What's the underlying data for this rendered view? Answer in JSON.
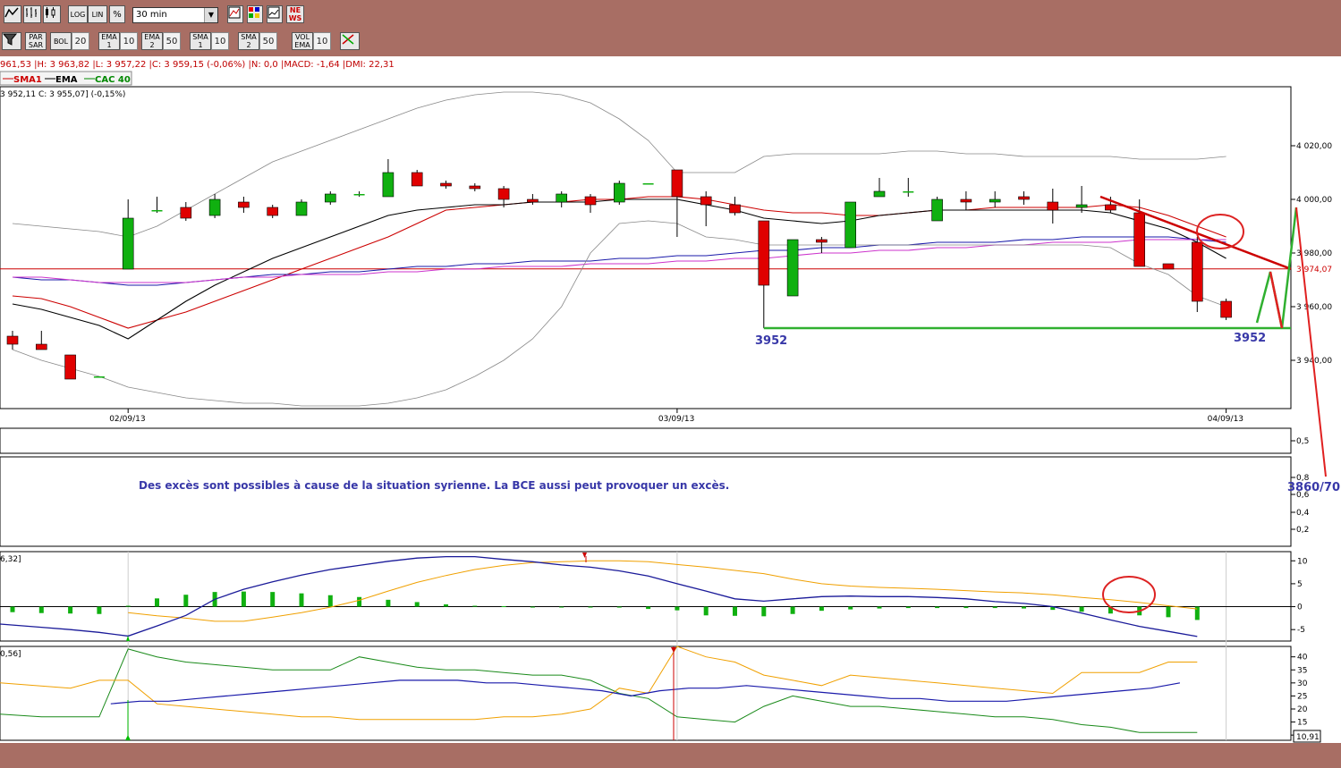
{
  "toolbar": {
    "interval": "30 min",
    "row1": [
      {
        "icon": "line-chart-icon"
      },
      {
        "icon": "bar-chart-icon"
      },
      {
        "icon": "candlestick-icon"
      },
      {
        "label": "LOG"
      },
      {
        "label": "LIN"
      },
      {
        "label": "%"
      }
    ],
    "row1_right": [
      {
        "icon": "compare-icon"
      },
      {
        "icon": "color-grid-icon"
      },
      {
        "icon": "chart-window-icon"
      },
      {
        "label": "NE WS"
      }
    ],
    "row2": [
      {
        "label": "PAR SAR"
      },
      {
        "label": "BOL",
        "value": "20"
      },
      {
        "label": "EMA 1",
        "value": "10"
      },
      {
        "label": "EMA 2",
        "value": "50"
      },
      {
        "label": "SMA 1",
        "value": "10"
      },
      {
        "label": "SMA 2",
        "value": "50"
      },
      {
        "label": "VOL EMA",
        "value": "10"
      }
    ]
  },
  "info": {
    "ohlc_line": "961,53 |H: 3 963,82 |L: 3 957,22 |C: 3 959,15 (-0,06%) |N: 0,0 |MACD: -1,64 |DMI: 22,31",
    "legend": [
      {
        "name": "SMA1",
        "color": "#cc0000"
      },
      {
        "name": "EMA",
        "color": "#000000"
      },
      {
        "name": "CAC 40",
        "color": "#008800"
      }
    ],
    "second_line": "3 952,11  C: 3 955,07] (-0,15%)"
  },
  "annotations": {
    "support_left": "3952",
    "support_right": "3952",
    "target": "3860/70",
    "comment": "Des excès sont possibles à cause de la situation syrienne. La BCE aussi peut provoquer un excès."
  },
  "panel_labels": {
    "macd": "6,32]",
    "dmi": "0,56]",
    "dmi_last": "10,91"
  },
  "colors": {
    "up": "#10b010",
    "down": "#e00000",
    "sma1": "#cc0000",
    "ema": "#000000",
    "long_ma": "#1a1aaa",
    "pink_ma": "#cc33cc",
    "bollinger": "#888888",
    "macd_signal": "#f0a000",
    "macd_line": "#1a1a99",
    "dmi_plus": "#1a8a1a",
    "dmi_minus": "#f0a000",
    "adx": "#1a1aaa",
    "support": "#30b030",
    "resistance": "#cc0000",
    "projection_up": "#30b030",
    "projection_down": "#e02020",
    "circle": "#dd2222"
  },
  "chart_data": [
    {
      "type": "candlestick",
      "title": "CAC 40",
      "interval": "30 min",
      "x_ticks": [
        "02/09/13",
        "03/09/13",
        "04/09/13"
      ],
      "y_ticks": [
        4020,
        4000,
        3980,
        3960,
        3940
      ],
      "y_tick_labels": [
        "4 020,00",
        "4 000,00",
        "3 980,00",
        "3 960,00",
        "3 940,00"
      ],
      "ylim": [
        3922,
        4042
      ],
      "last_price": 3974.07,
      "last_price_label": "3 974,07",
      "support_level": 3952,
      "candles": [
        {
          "o": 3949,
          "h": 3951,
          "l": 3944,
          "c": 3946
        },
        {
          "o": 3946,
          "h": 3951,
          "l": 3944,
          "c": 3944
        },
        {
          "o": 3942,
          "h": 3942,
          "l": 3933,
          "c": 3933
        },
        {
          "o": 3934,
          "h": 3934,
          "l": 3934,
          "c": 3934
        },
        {
          "o": 3974,
          "h": 4000,
          "l": 3974,
          "c": 3993
        },
        {
          "o": 3996,
          "h": 4001,
          "l": 3995,
          "c": 3996
        },
        {
          "o": 3997,
          "h": 3999,
          "l": 3992,
          "c": 3993
        },
        {
          "o": 3994,
          "h": 4002,
          "l": 3993,
          "c": 4000
        },
        {
          "o": 3999,
          "h": 4001,
          "l": 3995,
          "c": 3997
        },
        {
          "o": 3997,
          "h": 3998,
          "l": 3993,
          "c": 3994
        },
        {
          "o": 3994,
          "h": 4000,
          "l": 3994,
          "c": 3999
        },
        {
          "o": 3999,
          "h": 4003,
          "l": 3998,
          "c": 4002
        },
        {
          "o": 4002,
          "h": 4003,
          "l": 4001,
          "c": 4002
        },
        {
          "o": 4001,
          "h": 4015,
          "l": 4001,
          "c": 4010
        },
        {
          "o": 4010,
          "h": 4011,
          "l": 4005,
          "c": 4005
        },
        {
          "o": 4006,
          "h": 4007,
          "l": 4004,
          "c": 4005
        },
        {
          "o": 4005,
          "h": 4006,
          "l": 4003,
          "c": 4004
        },
        {
          "o": 4004,
          "h": 4005,
          "l": 3997,
          "c": 4000
        },
        {
          "o": 4000,
          "h": 4002,
          "l": 3998,
          "c": 3999
        },
        {
          "o": 3999,
          "h": 4003,
          "l": 3997,
          "c": 4002
        },
        {
          "o": 4001,
          "h": 4002,
          "l": 3995,
          "c": 3998
        },
        {
          "o": 3999,
          "h": 4007,
          "l": 3998,
          "c": 4006
        },
        {
          "o": 4006,
          "h": 4006,
          "l": 4006,
          "c": 4006
        },
        {
          "o": 4011,
          "h": 4011,
          "l": 3986,
          "c": 4001
        },
        {
          "o": 4001,
          "h": 4003,
          "l": 3990,
          "c": 3998
        },
        {
          "o": 3998,
          "h": 4001,
          "l": 3994,
          "c": 3995
        },
        {
          "o": 3992,
          "h": 3992,
          "l": 3952,
          "c": 3968
        },
        {
          "o": 3964,
          "h": 3985,
          "l": 3964,
          "c": 3985
        },
        {
          "o": 3985,
          "h": 3986,
          "l": 3980,
          "c": 3984
        },
        {
          "o": 3982,
          "h": 3999,
          "l": 3982,
          "c": 3999
        },
        {
          "o": 4001,
          "h": 4008,
          "l": 4001,
          "c": 4003
        },
        {
          "o": 4003,
          "h": 4008,
          "l": 4001,
          "c": 4003
        },
        {
          "o": 3992,
          "h": 4001,
          "l": 3992,
          "c": 4000
        },
        {
          "o": 4000,
          "h": 4003,
          "l": 3996,
          "c": 3999
        },
        {
          "o": 3999,
          "h": 4003,
          "l": 3997,
          "c": 4000
        },
        {
          "o": 4001,
          "h": 4003,
          "l": 3998,
          "c": 4000
        },
        {
          "o": 3999,
          "h": 4004,
          "l": 3991,
          "c": 3996
        },
        {
          "o": 3997,
          "h": 4005,
          "l": 3995,
          "c": 3998
        },
        {
          "o": 3998,
          "h": 4001,
          "l": 3995,
          "c": 3996
        },
        {
          "o": 3995,
          "h": 4000,
          "l": 3975,
          "c": 3975
        },
        {
          "o": 3976,
          "h": 3976,
          "l": 3974,
          "c": 3974
        },
        {
          "o": 3984,
          "h": 3986,
          "l": 3958,
          "c": 3962
        },
        {
          "o": 3962,
          "h": 3963,
          "l": 3955,
          "c": 3956
        }
      ],
      "ma_series": [
        {
          "key": "sma1",
          "values": [
            3964,
            3963,
            3960,
            3956,
            3952,
            3955,
            3958,
            3962,
            3966,
            3970,
            3974,
            3978,
            3982,
            3986,
            3991,
            3996,
            3997,
            3998,
            3999,
            3999,
            4000,
            4000,
            4001,
            4001,
            4000,
            3998,
            3996,
            3995,
            3995,
            3994,
            3994,
            3995,
            3996,
            3996,
            3997,
            3997,
            3997,
            3997,
            3998,
            3997,
            3994,
            3990,
            3986
          ]
        },
        {
          "key": "ema",
          "values": [
            3961,
            3959,
            3956,
            3953,
            3948,
            3955,
            3962,
            3968,
            3973,
            3978,
            3982,
            3986,
            3990,
            3994,
            3996,
            3997,
            3998,
            3998,
            3999,
            3999,
            3999,
            4000,
            4000,
            4000,
            3998,
            3996,
            3993,
            3992,
            3991,
            3992,
            3994,
            3995,
            3996,
            3996,
            3996,
            3996,
            3996,
            3996,
            3995,
            3992,
            3989,
            3984,
            3978
          ]
        },
        {
          "key": "long_ma",
          "values": [
            3971,
            3970,
            3970,
            3969,
            3968,
            3968,
            3969,
            3970,
            3971,
            3972,
            3972,
            3973,
            3973,
            3974,
            3975,
            3975,
            3976,
            3976,
            3977,
            3977,
            3977,
            3978,
            3978,
            3979,
            3979,
            3980,
            3981,
            3981,
            3982,
            3982,
            3983,
            3983,
            3984,
            3984,
            3984,
            3985,
            3985,
            3986,
            3986,
            3986,
            3986,
            3985,
            3984
          ]
        },
        {
          "key": "pink_ma",
          "values": [
            3971,
            3971,
            3970,
            3969,
            3969,
            3969,
            3969,
            3970,
            3971,
            3971,
            3972,
            3972,
            3972,
            3973,
            3973,
            3974,
            3974,
            3975,
            3975,
            3975,
            3976,
            3976,
            3976,
            3977,
            3977,
            3978,
            3978,
            3979,
            3980,
            3980,
            3981,
            3981,
            3982,
            3982,
            3983,
            3983,
            3984,
            3984,
            3984,
            3985,
            3985,
            3985,
            3985
          ]
        },
        {
          "key": "boll_up",
          "values": [
            3991,
            3990,
            3989,
            3988,
            3986,
            3990,
            3996,
            4002,
            4008,
            4014,
            4018,
            4022,
            4026,
            4030,
            4034,
            4037,
            4039,
            4040,
            4040,
            4039,
            4036,
            4030,
            4022,
            4010,
            4010,
            4010,
            4016,
            4017,
            4017,
            4017,
            4017,
            4018,
            4018,
            4017,
            4017,
            4016,
            4016,
            4016,
            4016,
            4015,
            4015,
            4015,
            4016
          ]
        },
        {
          "key": "boll_dn",
          "values": [
            3944,
            3940,
            3937,
            3934,
            3930,
            3928,
            3926,
            3925,
            3924,
            3924,
            3923,
            3923,
            3923,
            3924,
            3926,
            3929,
            3934,
            3940,
            3948,
            3960,
            3980,
            3991,
            3992,
            3991,
            3986,
            3985,
            3983,
            3983,
            3983,
            3983,
            3983,
            3983,
            3983,
            3983,
            3983,
            3983,
            3983,
            3983,
            3982,
            3976,
            3972,
            3964,
            3960
          ]
        }
      ]
    },
    {
      "type": "bar",
      "title": "MACD",
      "y_ticks": [
        10,
        5,
        0,
        -5
      ],
      "ylim": [
        -7.5,
        12
      ],
      "histogram": [
        -1.2,
        -1.4,
        -1.5,
        -1.6,
        0.2,
        1.8,
        2.6,
        3.2,
        3.3,
        3.2,
        2.9,
        2.5,
        2.1,
        1.5,
        1.0,
        0.5,
        0.2,
        0.1,
        0,
        0,
        0,
        -0.2,
        -0.5,
        -0.8,
        -1.9,
        -2.0,
        -2.1,
        -1.6,
        -0.9,
        -0.6,
        -0.4,
        -0.3,
        -0.3,
        -0.3,
        -0.3,
        -0.4,
        -0.7,
        -1.1,
        -1.5,
        -1.9,
        -2.3,
        -2.9
      ],
      "signal": [
        -1.3,
        -2.0,
        -2.5,
        -3.2,
        -3.2,
        -2.3,
        -1.3,
        -0.1,
        1.4,
        3.4,
        5.3,
        6.8,
        8.1,
        9.0,
        9.6,
        9.8,
        10.0,
        10.0,
        9.8,
        9.2,
        8.6,
        7.9,
        7.2,
        6.0,
        5.0,
        4.5,
        4.2,
        4.0,
        3.8,
        3.5,
        3.2,
        3.0,
        2.6,
        2.0,
        1.5,
        0.9,
        0.2,
        -0.5
      ],
      "macd": [
        -4.5,
        -5.0,
        -5.6,
        -6.4,
        -4.2,
        -1.9,
        1.6,
        3.8,
        5.4,
        6.9,
        8.1,
        9.0,
        9.9,
        10.6,
        10.9,
        10.9,
        10.3,
        9.8,
        9.1,
        8.6,
        7.8,
        6.7,
        5.0,
        3.4,
        1.7,
        1.2,
        1.7,
        2.2,
        2.3,
        2.2,
        2.2,
        2.0,
        1.7,
        1.1,
        0.7,
        0.0,
        -1.4,
        -2.9,
        -4.3,
        -5.4,
        -6.5
      ]
    },
    {
      "type": "line",
      "title": "DMI",
      "y_ticks": [
        40,
        35,
        30,
        25,
        20,
        15,
        10
      ],
      "ylim": [
        8,
        44
      ],
      "last_value": 10.91,
      "dmi_plus": [
        18,
        17,
        17,
        17,
        43,
        40,
        38,
        37,
        36,
        35,
        35,
        35,
        40,
        38,
        36,
        35,
        35,
        34,
        33,
        33,
        31,
        26,
        24,
        17,
        16,
        15,
        21,
        25,
        23,
        21,
        21,
        20,
        19,
        18,
        17,
        17,
        16,
        14,
        13,
        11,
        11,
        11
      ],
      "dmi_minus": [
        30,
        28,
        31,
        31,
        22,
        21,
        20,
        19,
        18,
        17,
        17,
        16,
        16,
        16,
        16,
        16,
        17,
        17,
        18,
        20,
        28,
        26,
        44,
        40,
        38,
        33,
        31,
        29,
        33,
        32,
        31,
        30,
        29,
        28,
        27,
        26,
        34,
        34,
        34,
        38,
        38
      ],
      "adx": [
        22,
        23,
        23,
        24,
        25,
        26,
        27,
        28,
        29,
        30,
        31,
        31,
        31,
        30,
        30,
        29,
        28,
        27,
        25,
        27,
        28,
        28,
        29,
        28,
        27,
        26,
        25,
        24,
        24,
        23,
        23,
        23,
        24,
        25,
        26,
        27,
        28,
        30
      ]
    }
  ]
}
